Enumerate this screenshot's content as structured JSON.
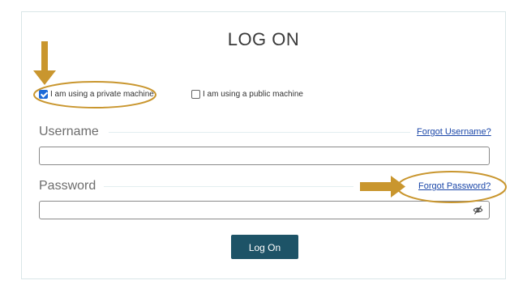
{
  "form": {
    "title": "LOG ON",
    "private_machine_label": "I am using a private machine",
    "private_machine_checked": true,
    "public_machine_label": "I am using a public machine",
    "public_machine_checked": false,
    "username_label": "Username",
    "forgot_username": "Forgot Username?",
    "username_value": "",
    "password_label": "Password",
    "forgot_password": "Forgot Password?",
    "password_value": "",
    "logon_button": "Log On"
  },
  "icons": {
    "password_toggle": "eye-slash-icon",
    "annotation_arrows": "arrow-icon"
  },
  "colors": {
    "button": "#1d5367",
    "link": "#1a46a8",
    "checkbox_checked": "#1d6ad8",
    "annotation": "#c9962e"
  }
}
